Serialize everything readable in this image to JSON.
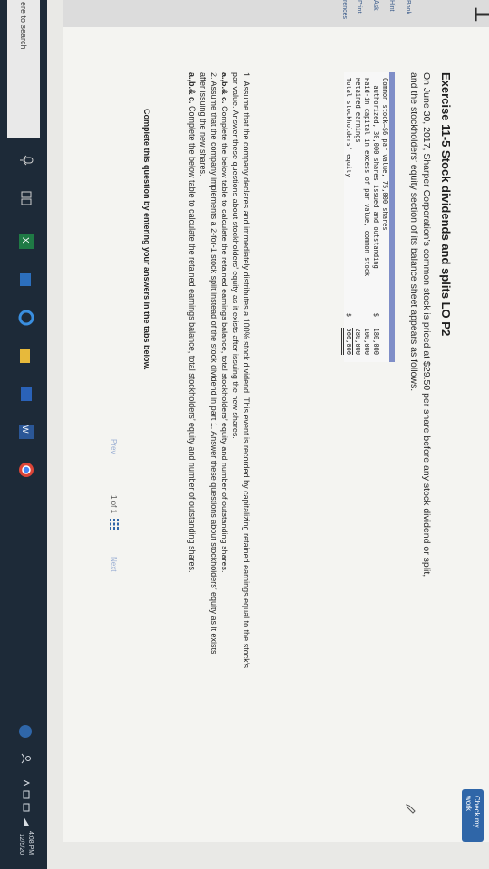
{
  "header": {
    "page_number": "1",
    "check_work_label": "Check my work"
  },
  "sidebar": {
    "items": [
      {
        "label": "Book"
      },
      {
        "label": "Hint"
      },
      {
        "label": "Ask"
      },
      {
        "label": "Print"
      },
      {
        "label": "rences"
      }
    ]
  },
  "exercise": {
    "title": "Exercise 11-5 Stock dividends and splits LO P2",
    "intro": "On June 30, 2017, Sharper Corporation’s common stock is priced at $29.50 per share before any stock dividend or split, and the stockholders’ equity section of its balance sheet appears as follows."
  },
  "balance_sheet": {
    "rows": [
      {
        "label": "Common stock—$6 par value, 75,000 shares",
        "dollar": "",
        "amount": ""
      },
      {
        "label": "  authorized, 30,000 shares issued and outstanding",
        "dollar": "$",
        "amount": "180,000"
      },
      {
        "label": "Paid-in capital in excess of par value, common stock",
        "dollar": "",
        "amount": "100,000"
      },
      {
        "label": "Retained earnings",
        "dollar": "",
        "amount": "280,000"
      },
      {
        "label": "Total stockholders’ equity",
        "dollar": "$",
        "amount": "560,000"
      }
    ]
  },
  "questions": {
    "q1": "1. Assume that the company declares and immediately distributes a 100% stock dividend. This event is recorded by capitalizing retained earnings equal to the stock’s par value. Answer these questions about stockholders’ equity as it exists after issuing the new shares.",
    "q1abc_prefix": "a.,b.& c.",
    "q1abc": " Complete the below table to calculate the retained earnings balance, total stockholders’ equity and number of outstanding shares.",
    "q2": "2. Assume that the company implements a 2-for-1 stock split instead of the stock dividend in part 1. Answer these questions about stockholders’ equity as it exists after issuing the new shares.",
    "q2abc_prefix": "a.,b.& c.",
    "q2abc": " Complete the below table to calculate the retained earnings balance, total stockholders’ equity and number of outstanding shares."
  },
  "footer": {
    "complete_note": "Complete this question by entering your answers in the tabs below.",
    "prev_label": "Prev",
    "page_indicator": "1 of 1",
    "next_label": "Next"
  },
  "taskbar": {
    "search_placeholder": "ere to search",
    "clock_time": "4:08 PM",
    "clock_date": "12/5/20"
  },
  "colors": {
    "accent": "#2f66a8",
    "table_header": "#7f8ec8",
    "taskbar": "#1d2a38"
  }
}
